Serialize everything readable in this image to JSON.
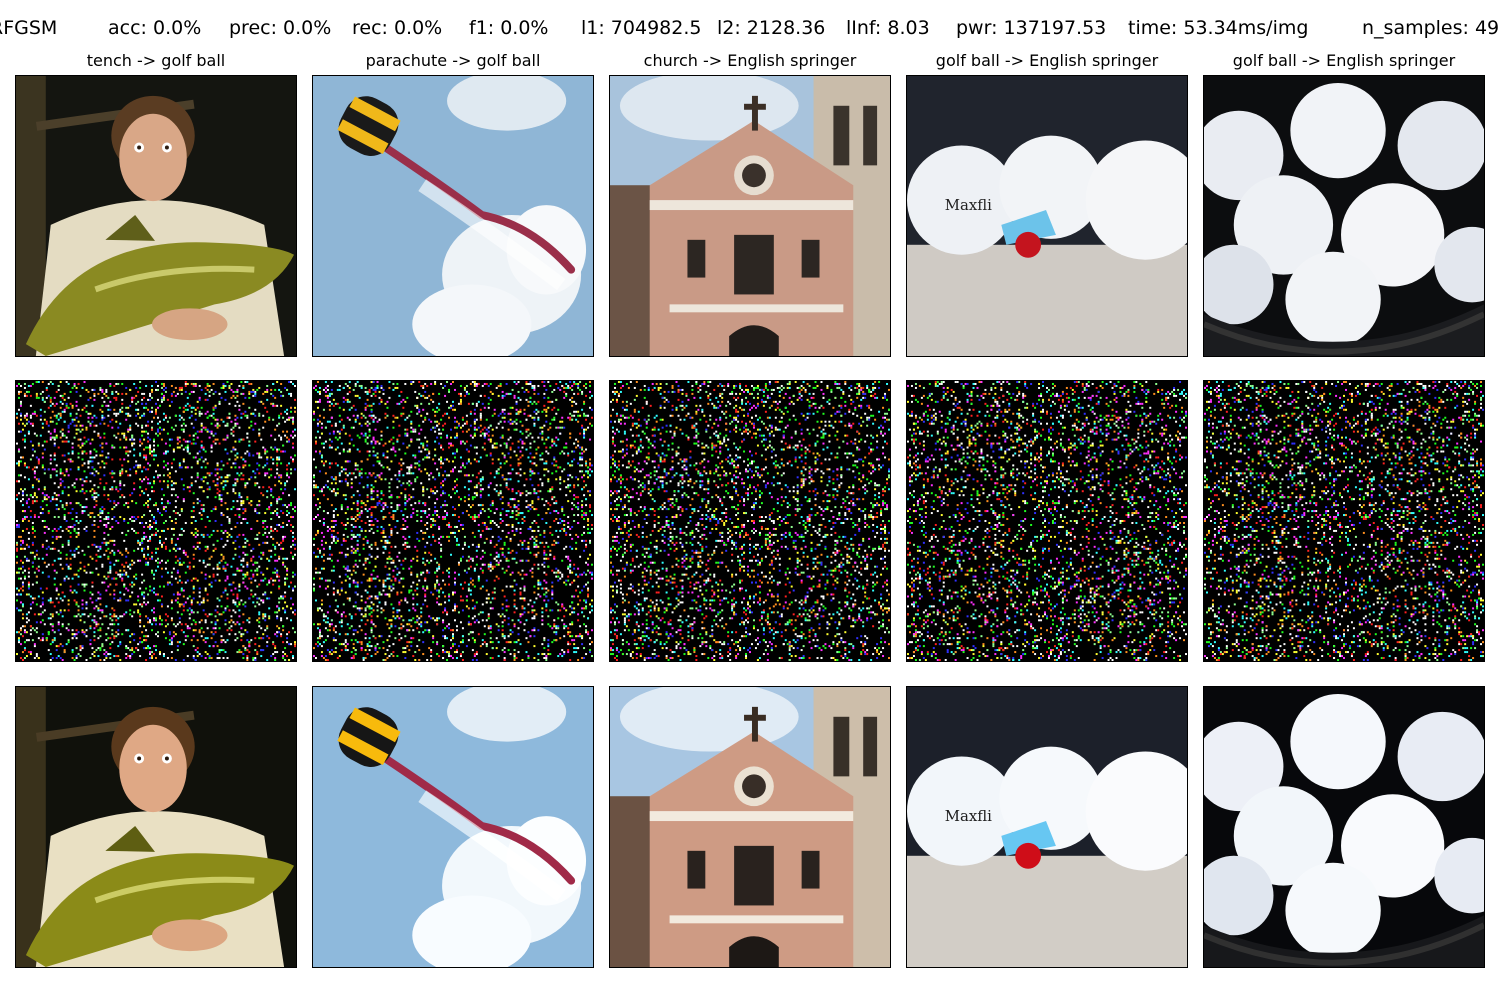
{
  "header": {
    "method": "RFGSM",
    "acc": "acc: 0.0%",
    "prec": "prec: 0.0%",
    "rec": "rec: 0.0%",
    "f1": "f1: 0.0%",
    "l1": "l1: 704982.5",
    "l2": "l2: 2128.36",
    "linf": "lInf: 8.03",
    "pwr": "pwr: 137197.53",
    "time": "time: 53.34ms/img",
    "n_samples": "n_samples: 49"
  },
  "columns": [
    {
      "title": "tench -> golf ball",
      "scene": "man holding a tench fish"
    },
    {
      "title": "parachute -> golf ball",
      "scene": "parachute with smoke trail in sky"
    },
    {
      "title": "church -> English springer",
      "scene": "church facade"
    },
    {
      "title": "golf ball -> English springer",
      "scene": "golf balls with tee"
    },
    {
      "title": "golf ball -> English springer",
      "scene": "golf balls in basket"
    }
  ],
  "rows": [
    "original",
    "perturbation",
    "adversarial"
  ],
  "colors": {
    "background": "#ffffff",
    "text": "#000000",
    "noise_background": "#000000",
    "sky": "#8fb6d6",
    "fish": "#8a8a22",
    "church": "#c99a86",
    "golf_ball": "#eef1f5"
  }
}
